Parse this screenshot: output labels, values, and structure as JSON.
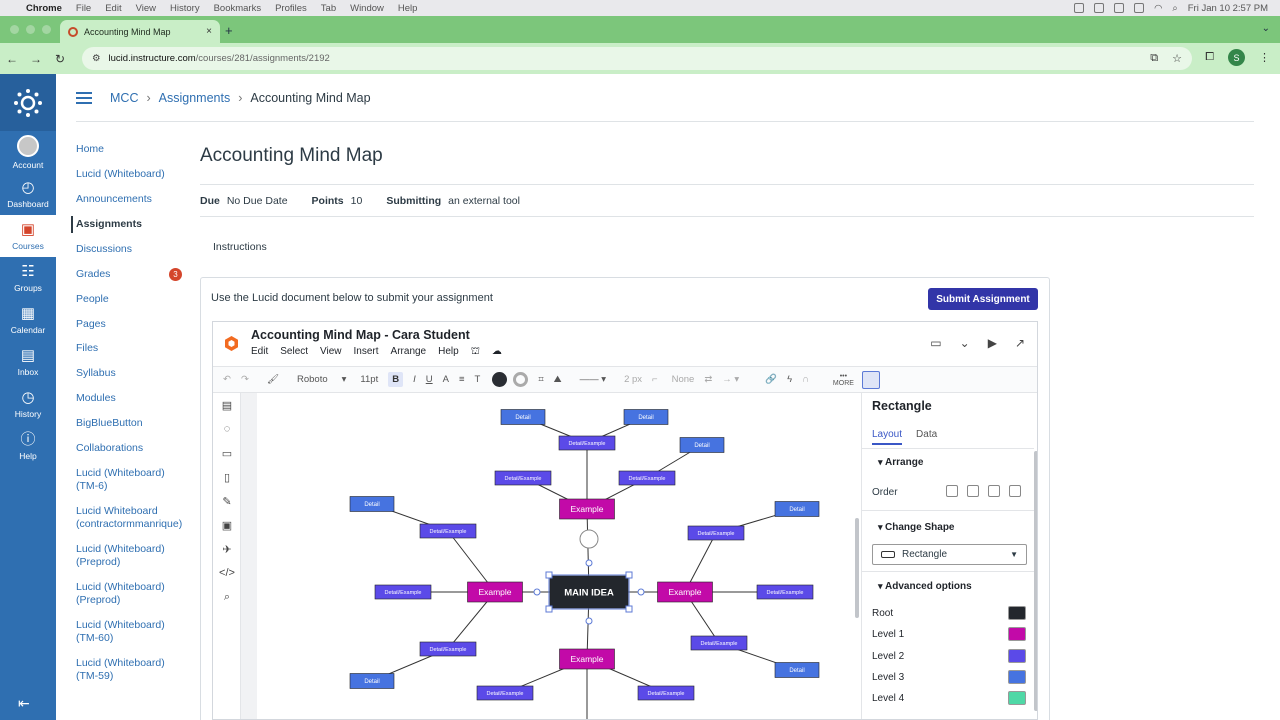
{
  "menubar": {
    "app": "Chrome",
    "items": [
      "File",
      "Edit",
      "View",
      "History",
      "Bookmarks",
      "Profiles",
      "Tab",
      "Window",
      "Help"
    ],
    "clock": "Fri Jan 10  2:57 PM"
  },
  "browser": {
    "tab_title": "Accounting Mind Map",
    "url_domain": "lucid.instructure.com",
    "url_path": "/courses/281/assignments/2192",
    "profile_letter": "S"
  },
  "global_nav": [
    {
      "label": "Account",
      "icon": "account-avatar-icon"
    },
    {
      "label": "Dashboard",
      "icon": "dashboard-icon"
    },
    {
      "label": "Courses",
      "icon": "courses-icon"
    },
    {
      "label": "Groups",
      "icon": "groups-icon"
    },
    {
      "label": "Calendar",
      "icon": "calendar-icon"
    },
    {
      "label": "Inbox",
      "icon": "inbox-icon"
    },
    {
      "label": "History",
      "icon": "history-icon"
    },
    {
      "label": "Help",
      "icon": "help-icon"
    }
  ],
  "breadcrumb": {
    "course": "MCC",
    "section": "Assignments",
    "current": "Accounting Mind Map"
  },
  "course_nav": [
    "Home",
    "Lucid (Whiteboard)",
    "Announcements",
    "Assignments",
    "Discussions",
    "Grades",
    "People",
    "Pages",
    "Files",
    "Syllabus",
    "Modules",
    "BigBlueButton",
    "Collaborations",
    "Lucid (Whiteboard) (TM-6)",
    "Lucid Whiteboard (contractormmanrique)",
    "Lucid (Whiteboard) (Preprod)",
    "Lucid (Whiteboard) (Preprod)",
    "Lucid (Whiteboard) (TM-60)",
    "Lucid (Whiteboard) (TM-59)"
  ],
  "grades_badge": "3",
  "assignment": {
    "title": "Accounting Mind Map",
    "due_label": "Due",
    "due_value": "No Due Date",
    "points_label": "Points",
    "points_value": "10",
    "submitting_label": "Submitting",
    "submitting_value": "an external tool",
    "instructions": "Instructions",
    "use_text": "Use the Lucid document below to submit your assignment",
    "submit_label": "Submit Assignment"
  },
  "lucid": {
    "doc_title": "Accounting Mind Map - Cara Student",
    "menu": [
      "Edit",
      "Select",
      "View",
      "Insert",
      "Arrange",
      "Help"
    ],
    "toolbar": {
      "font": "Roboto",
      "size": "11pt",
      "stroke": "2 px",
      "end": "None",
      "more": "MORE"
    },
    "map": {
      "main": "MAIN IDEA",
      "example": "Example",
      "detail_example": "Detail/Example",
      "detail": "Detail"
    },
    "panel": {
      "title": "Rectangle",
      "tabs": [
        "Layout",
        "Data"
      ],
      "arrange": "Arrange",
      "order": "Order",
      "change_shape": "Change Shape",
      "shape_value": "Rectangle",
      "advanced": "Advanced options",
      "levels": [
        {
          "label": "Root",
          "color": "#23272d"
        },
        {
          "label": "Level 1",
          "color": "#c20aa8"
        },
        {
          "label": "Level 2",
          "color": "#5b4ae8"
        },
        {
          "label": "Level 3",
          "color": "#4673e0"
        },
        {
          "label": "Level 4",
          "color": "#4fd8a6"
        }
      ]
    }
  },
  "colors": {
    "canvas_blue": "#2f6fb1",
    "chrome_green": "#7cc67b",
    "submit_button": "#3235a8",
    "root_node": "#23272d",
    "level1_node": "#c20aa8",
    "level2_node": "#5b4ae8",
    "level3_node": "#4673e0"
  }
}
